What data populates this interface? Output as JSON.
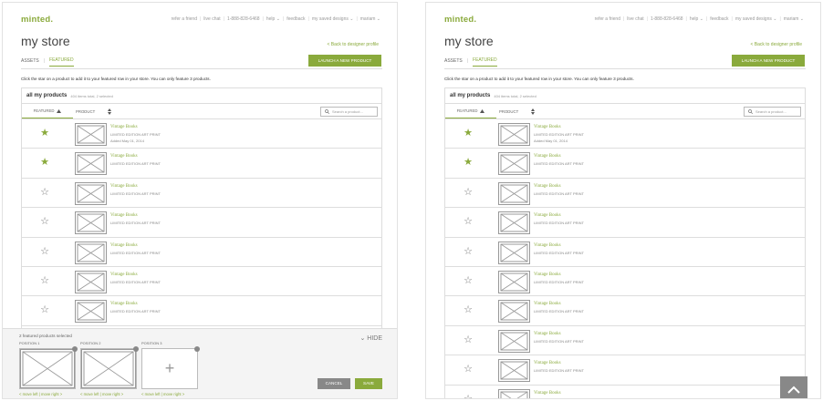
{
  "header": {
    "logo": "minted.",
    "nav": [
      "refer a friend",
      "live chat",
      "1-888-828-6468",
      "help ⌄",
      "feedback",
      "my saved designs ⌄",
      "mariam ⌄"
    ],
    "title": "my store",
    "back_link": "< Back to designer profile"
  },
  "tabs": {
    "assets": "ASSETS",
    "sep": "|",
    "featured": "FEATURED"
  },
  "launch_button": "LAUNCH A NEW PRODUCT",
  "instruction": "Click the star on a product to add it to your featured row in your store. You can only feature 3 products.",
  "table": {
    "title": "all my products",
    "count": "404 items total, 2 selected",
    "col_featured": "FEATURED",
    "col_product": "PRODUCT",
    "search_placeholder": "Search a product...",
    "rows": [
      {
        "name": "Vintage Books",
        "type": "LIMITED EDITION ART PRINT",
        "added": "Added May 01, 2014",
        "starred": true
      },
      {
        "name": "Vintage Books",
        "type": "LIMITED EDITION ART PRINT",
        "added": "",
        "starred": true
      },
      {
        "name": "Vintage Books",
        "type": "LIMITED EDITION ART PRINT",
        "added": "",
        "starred": false
      },
      {
        "name": "Vintage Books",
        "type": "LIMITED EDITION ART PRINT",
        "added": "",
        "starred": false
      },
      {
        "name": "Vintage Books",
        "type": "LIMITED EDITION ART PRINT",
        "added": "",
        "starred": false
      },
      {
        "name": "Vintage Books",
        "type": "LIMITED EDITION ART PRINT",
        "added": "",
        "starred": false
      },
      {
        "name": "Vintage Books",
        "type": "LIMITED EDITION ART PRINT",
        "added": "",
        "starred": false
      },
      {
        "name": "Vintage Books",
        "type": "LIMITED EDITION ART PRINT",
        "added": "",
        "starred": false
      },
      {
        "name": "Vintage Books",
        "type": "LIMITED EDITION ART PRINT",
        "added": "",
        "starred": false
      },
      {
        "name": "Vintage Books",
        "type": "LIMITED EDITION ART PRINT",
        "added": "",
        "starred": false
      }
    ]
  },
  "tray": {
    "message": "2 featured products selected",
    "hide": "⌄ HIDE",
    "positions": [
      {
        "label": "POSITION 1",
        "move": "< move left | move right >",
        "empty": false
      },
      {
        "label": "POSITION 2",
        "move": "< move left | move right >",
        "empty": false
      },
      {
        "label": "POSITION 3",
        "move": "< move left | move right >",
        "empty": true
      }
    ],
    "cancel": "CANCEL",
    "save": "SAVE"
  },
  "icons": {
    "star_filled": "star-icon",
    "star_empty": "star-outline-icon",
    "sort": "sort-icon",
    "search": "search-icon",
    "to_top": "chevron-up-icon"
  },
  "colors": {
    "accent": "#8aaa3c",
    "gray": "#888888"
  }
}
